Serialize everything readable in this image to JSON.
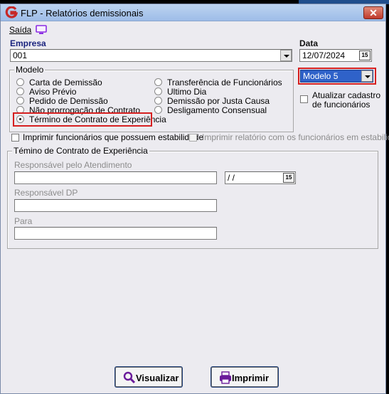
{
  "window": {
    "title": "FLP - Relatórios demissionais",
    "close_label": "✕"
  },
  "menu": {
    "saida_label": "Saída"
  },
  "empresa": {
    "label": "Empresa",
    "value": "001"
  },
  "data": {
    "label": "Data",
    "value": "12/07/2024"
  },
  "modelo_select": {
    "value": "Modelo 5"
  },
  "modelo_group": {
    "legend": "Modelo",
    "left_options": [
      "Carta de Demissão",
      "Aviso Prévio",
      "Pedido de Demissão",
      "Não prorrogação de Contrato",
      "Término de Contrato de Experiência"
    ],
    "right_options": [
      "Transferência de Funcionários",
      "Ultimo Dia",
      "Demissão por Justa Causa",
      "Desligamento Consensual"
    ],
    "selected": "Término de Contrato de Experiência"
  },
  "atualizar": {
    "label_line1": "Atualizar cadastro",
    "label_line2": "de funcionários"
  },
  "chk_estabilidade": {
    "label": "Imprimir funcionários que possuem estabilidade"
  },
  "chk_relatorio": {
    "label": "Imprimir relatório com os funcionários em estabilidade"
  },
  "termino_group": {
    "legend": "Témino de Contrato de Experiência",
    "responsavel_atendimento_label": "Responsável pelo Atendimento",
    "date_value": " / /",
    "responsavel_dp_label": "Responsável  DP",
    "para_label": "Para"
  },
  "buttons": {
    "visualizar": "Visualizar",
    "imprimir": "Imprimir"
  },
  "colors": {
    "accent": "#2f62c9",
    "highlight": "#d62020",
    "title_bar": "#9ebde8"
  }
}
